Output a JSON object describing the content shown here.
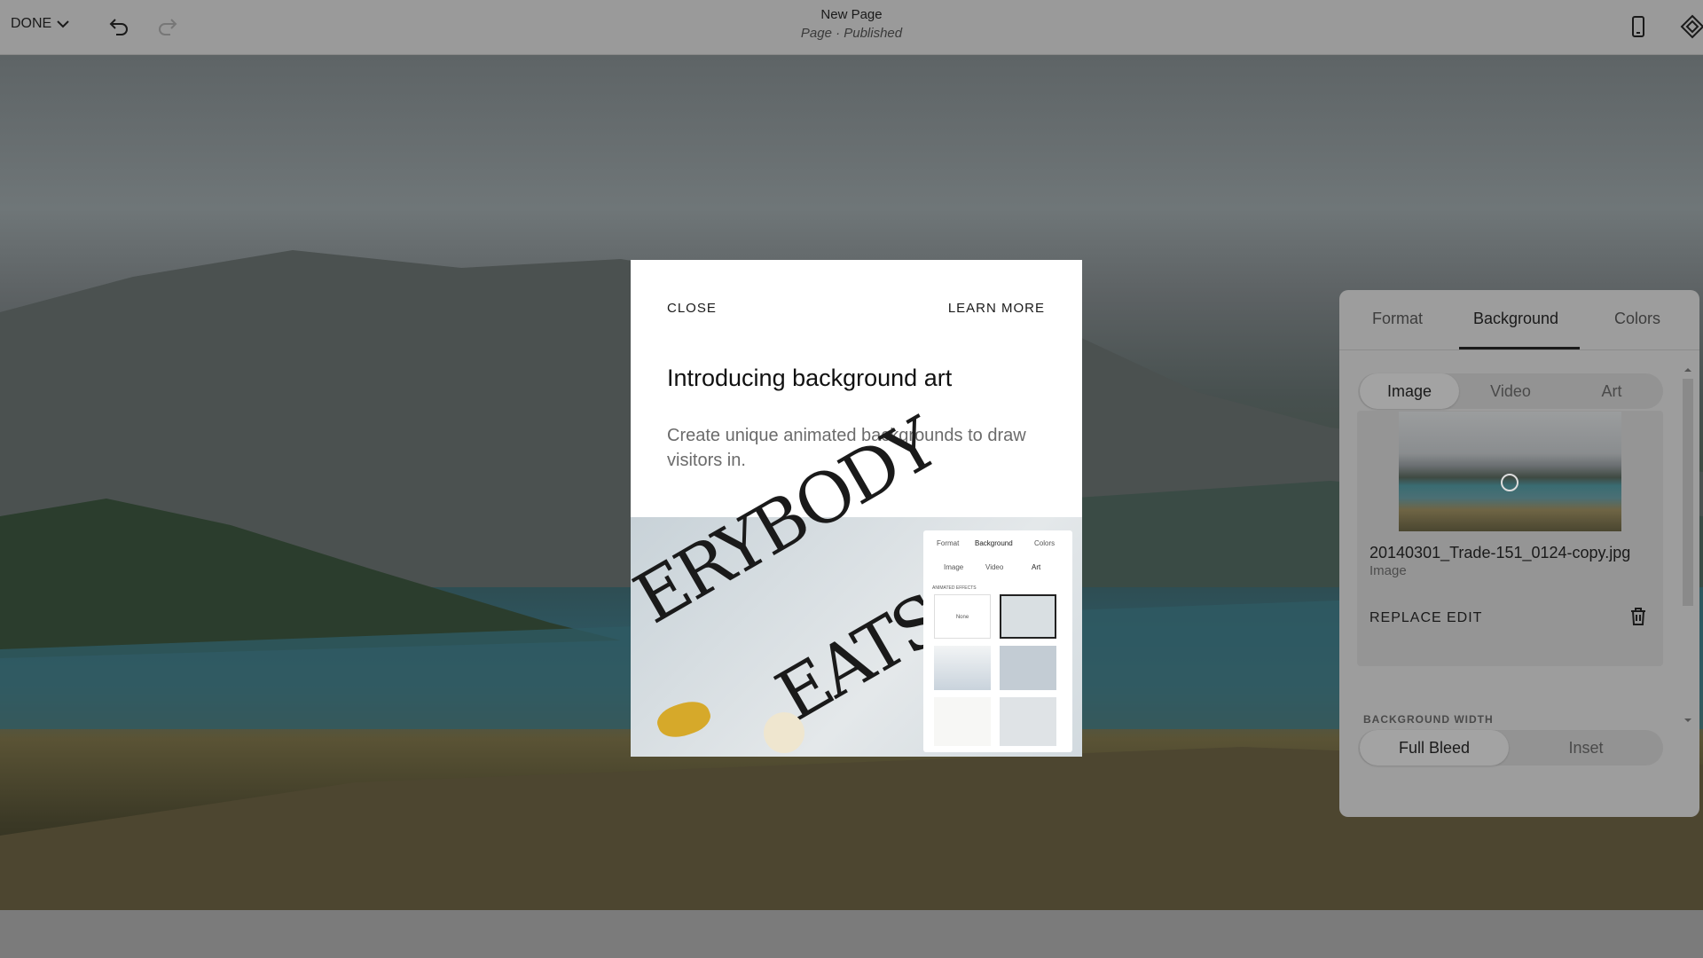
{
  "topbar": {
    "done_label": "DONE",
    "page_title": "New Page",
    "page_status": "Page · Published",
    "icons": [
      "chevron-down-icon",
      "undo-icon",
      "redo-icon",
      "mobile-preview-icon",
      "style-icon"
    ]
  },
  "modal": {
    "close_label": "CLOSE",
    "learn_more_label": "LEARN MORE",
    "heading": "Introducing background art",
    "description": "Create unique animated backgrounds to draw visitors in.",
    "preview": {
      "headline_top": "ERYBODY",
      "headline_bottom": "EATS",
      "tabs": [
        "Format",
        "Background",
        "Colors"
      ],
      "segments": [
        "Image",
        "Video",
        "Art"
      ],
      "section_label": "ANIMATED EFFECTS",
      "none_label": "None"
    }
  },
  "panel": {
    "tabs": [
      {
        "label": "Format"
      },
      {
        "label": "Background",
        "active": true
      },
      {
        "label": "Colors"
      }
    ],
    "source_options": [
      {
        "label": "Image",
        "selected": true
      },
      {
        "label": "Video"
      },
      {
        "label": "Art"
      }
    ],
    "file_name": "20140301_Trade-151_0124-copy.jpg",
    "file_type": "Image",
    "replace_label": "REPLACE",
    "edit_label": "EDIT",
    "width_label": "BACKGROUND WIDTH",
    "width_options": [
      {
        "label": "Full Bleed",
        "selected": true
      },
      {
        "label": "Inset"
      }
    ]
  }
}
